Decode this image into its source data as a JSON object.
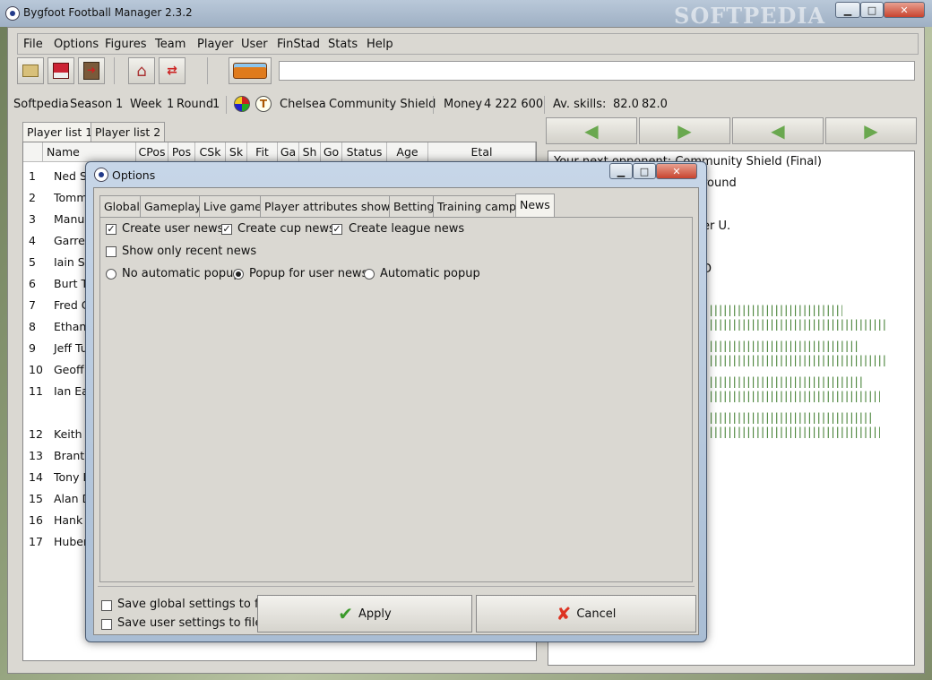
{
  "window": {
    "title": "Bygfoot Football Manager 2.3.2",
    "watermark": "SOFTPEDIA"
  },
  "menu": [
    "File",
    "Options",
    "Figures",
    "Team",
    "Player",
    "User",
    "FinStad",
    "Stats",
    "Help"
  ],
  "toolbar": {
    "icons": [
      "open-folder-icon",
      "save-icon",
      "exit-icon",
      "home-icon",
      "transfer-icon",
      "bus-icon"
    ],
    "field": ""
  },
  "status": {
    "user": "Softpedia",
    "season_label": "Season",
    "season": "1",
    "week_label": "Week",
    "week": "1",
    "round_label": "Round",
    "round": "1",
    "team": "Chelsea",
    "competition": "Community Shield",
    "money_label": "Money",
    "money": "4 222 600",
    "avskills_label": "Av. skills:",
    "avskills1": "82.0",
    "avskills2": "82.0"
  },
  "player_tabs": [
    "Player list 1",
    "Player list 2"
  ],
  "columns": [
    "Name",
    "CPos",
    "Pos",
    "CSk",
    "Sk",
    "Fit",
    "Ga",
    "Sh",
    "Go",
    "Status",
    "Age",
    "Etal"
  ],
  "players": [
    {
      "num": "1",
      "name": "Ned Sag"
    },
    {
      "num": "2",
      "name": "Tommy"
    },
    {
      "num": "3",
      "name": "Manuel"
    },
    {
      "num": "4",
      "name": "Garrett"
    },
    {
      "num": "5",
      "name": "Iain Sta"
    },
    {
      "num": "6",
      "name": "Burt Tho"
    },
    {
      "num": "7",
      "name": "Fred Ca"
    },
    {
      "num": "8",
      "name": "Ethan M"
    },
    {
      "num": "9",
      "name": "Jeff Tug"
    },
    {
      "num": "10",
      "name": "Geoff La"
    },
    {
      "num": "11",
      "name": "Ian Eato"
    },
    {
      "num": "12",
      "name": "Keith Ka"
    },
    {
      "num": "13",
      "name": "Brant St"
    },
    {
      "num": "14",
      "name": "Tony De"
    },
    {
      "num": "15",
      "name": "Alan Dil"
    },
    {
      "num": "16",
      "name": "Hank Es"
    },
    {
      "num": "17",
      "name": "Hubert T"
    }
  ],
  "right_panel": {
    "line1": "Your next opponent: Community Shield (Final)",
    "line2": "round",
    "line3": "er U.",
    "line4": ")",
    "line5": "D"
  },
  "dialog": {
    "title": "Options",
    "tabs": [
      "Global",
      "Gameplay",
      "Live game",
      "Player attributes shown",
      "Betting",
      "Training camp",
      "News"
    ],
    "active_tab": "News",
    "checks": [
      {
        "label": "Create user news",
        "checked": true
      },
      {
        "label": "Create cup news",
        "checked": true
      },
      {
        "label": "Create league news",
        "checked": true
      }
    ],
    "recent": {
      "label": "Show only recent news",
      "checked": false
    },
    "radios": [
      {
        "label": "No automatic popup",
        "selected": false
      },
      {
        "label": "Popup for user news",
        "selected": true
      },
      {
        "label": "Automatic popup",
        "selected": false
      }
    ],
    "save_global": "Save global settings to file",
    "save_user": "Save user settings to file",
    "apply": "Apply",
    "cancel": "Cancel"
  },
  "colors": {
    "bars": "#3b7a2a",
    "arrows": "#6aa84f",
    "selected_row": "#9db3d6"
  }
}
